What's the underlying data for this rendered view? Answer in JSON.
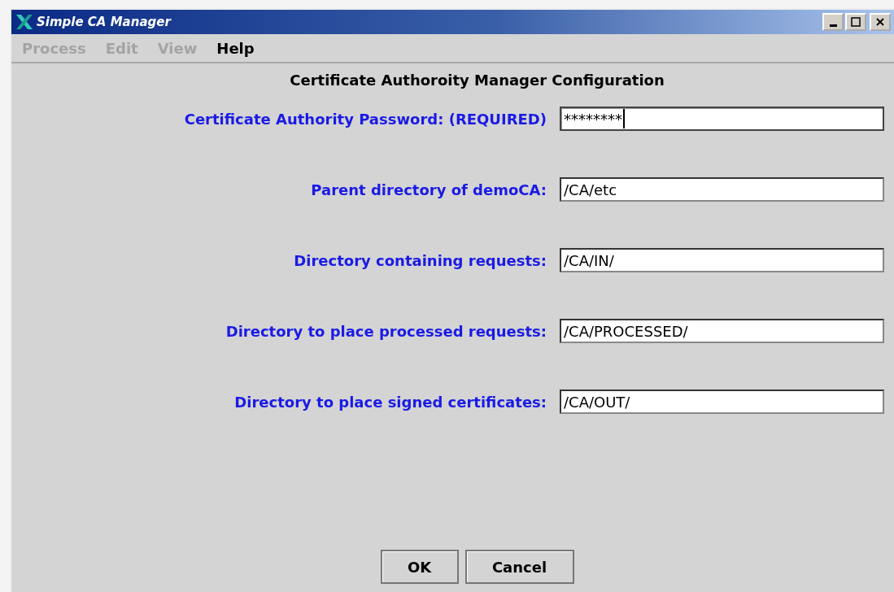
{
  "window": {
    "title": "Simple CA Manager"
  },
  "menu": [
    {
      "label": "Process",
      "disabled": true
    },
    {
      "label": "Edit",
      "disabled": true
    },
    {
      "label": "View",
      "disabled": true
    },
    {
      "label": "Help",
      "disabled": false
    }
  ],
  "heading": "Certificate Authoroity Manager Configuration",
  "fields": [
    {
      "label": "Certificate Authority Password: (REQUIRED)",
      "value": "********",
      "focused": true
    },
    {
      "label": "Parent directory of demoCA:",
      "value": "/CA/etc",
      "focused": false
    },
    {
      "label": "Directory containing requests:",
      "value": "/CA/IN/",
      "focused": false
    },
    {
      "label": "Directory to place processed requests:",
      "value": "/CA/PROCESSED/",
      "focused": false
    },
    {
      "label": "Directory to place signed certificates:",
      "value": "/CA/OUT/",
      "focused": false
    }
  ],
  "buttons": [
    "OK",
    "Cancel"
  ]
}
